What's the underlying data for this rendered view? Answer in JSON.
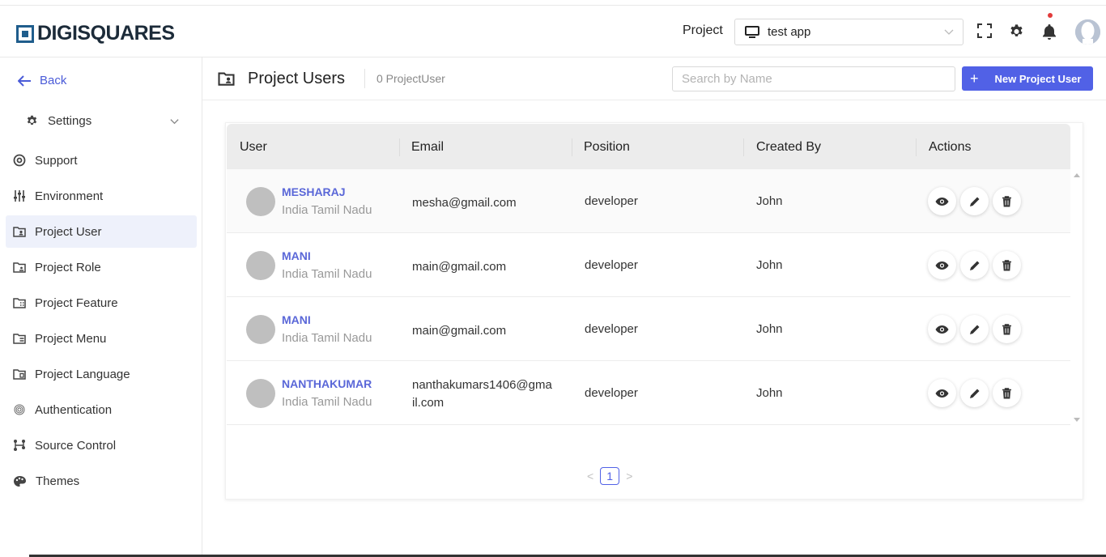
{
  "brand": {
    "name": "DIGISQUARES"
  },
  "topbar": {
    "project_label": "Project",
    "project_value": "test app",
    "icons": [
      "fullscreen-icon",
      "gear-icon",
      "bell-icon",
      "user-avatar"
    ]
  },
  "sidebar": {
    "back_label": "Back",
    "settings_label": "Settings",
    "items": [
      {
        "label": "Support",
        "icon": "support-icon",
        "active": false
      },
      {
        "label": "Environment",
        "icon": "sliders-icon",
        "active": false
      },
      {
        "label": "Project User",
        "icon": "folder-user-icon",
        "active": true
      },
      {
        "label": "Project Role",
        "icon": "folder-role-icon",
        "active": false
      },
      {
        "label": "Project Feature",
        "icon": "folder-feature-icon",
        "active": false
      },
      {
        "label": "Project Menu",
        "icon": "folder-menu-icon",
        "active": false
      },
      {
        "label": "Project Language",
        "icon": "folder-language-icon",
        "active": false
      },
      {
        "label": "Authentication",
        "icon": "fingerprint-icon",
        "active": false
      },
      {
        "label": "Source Control",
        "icon": "git-icon",
        "active": false
      },
      {
        "label": "Themes",
        "icon": "palette-icon",
        "active": false
      }
    ]
  },
  "header": {
    "title": "Project Users",
    "count": "0 ProjectUser",
    "search_placeholder": "Search by Name",
    "new_button": "New Project User"
  },
  "table": {
    "columns": [
      "User",
      "Email",
      "Position",
      "Created By",
      "Actions"
    ],
    "rows": [
      {
        "name": "MESHARAJ",
        "location": "India Tamil Nadu",
        "email": "mesha@gmail.com",
        "position": "developer",
        "created_by": "John"
      },
      {
        "name": "MANI",
        "location": "India Tamil Nadu",
        "email": "main@gmail.com",
        "position": "developer",
        "created_by": "John"
      },
      {
        "name": "MANI",
        "location": "India Tamil Nadu",
        "email": "main@gmail.com",
        "position": "developer",
        "created_by": "John"
      },
      {
        "name": "NANTHAKUMAR",
        "location": "India Tamil Nadu",
        "email": "nanthakumars1406@gmail.com",
        "position": "developer",
        "created_by": "John"
      }
    ]
  },
  "pagination": {
    "current": "1"
  },
  "colors": {
    "accent": "#5161e6",
    "link": "#5a67d8",
    "active_bg": "#eef1fb"
  }
}
